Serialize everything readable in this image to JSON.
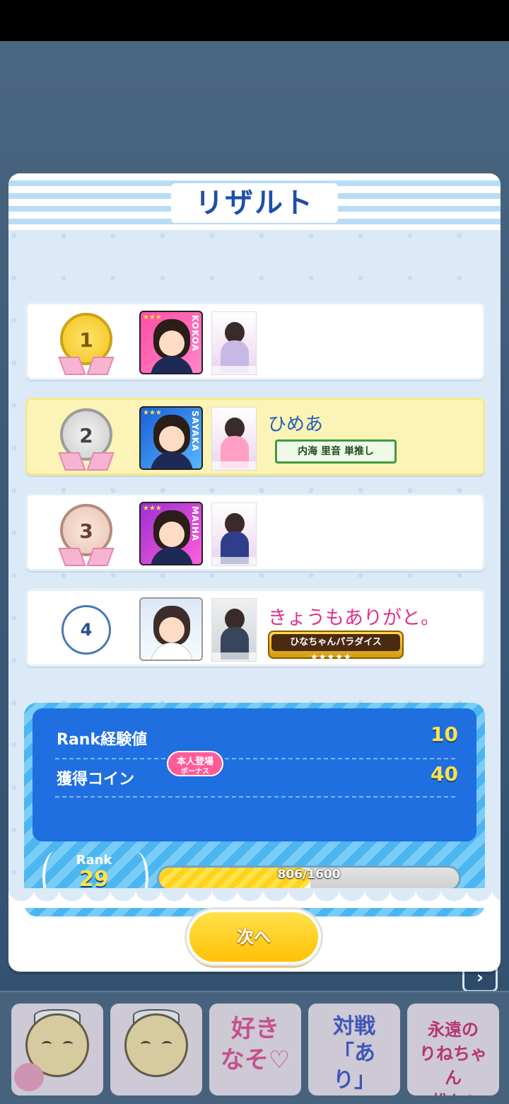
{
  "modal": {
    "title": "リザルト",
    "next_label": "次へ"
  },
  "results": [
    {
      "rank": "1",
      "avatar_name": "KOKOA",
      "player_name": "",
      "tag": ""
    },
    {
      "rank": "2",
      "avatar_name": "SAYAKA",
      "player_name": "ひめあ",
      "tag": "内海 里音 単推し"
    },
    {
      "rank": "3",
      "avatar_name": "MAIHA",
      "player_name": "",
      "tag": ""
    },
    {
      "rank": "4",
      "avatar_name": "",
      "player_name": "きょうもありがと。",
      "tag": "ひなちゃんパラダイス"
    }
  ],
  "stats": {
    "rank_exp_label": "Rank経験値",
    "rank_exp_value": "10",
    "coin_label": "獲得コイン",
    "coin_value": "40",
    "bonus_label": "本人登場",
    "bonus_sub": "ボーナス",
    "rank_label": "Rank",
    "rank_value": "29",
    "xp_text": "806/1600",
    "xp_current": 806,
    "xp_max": 1600
  },
  "stamps": [
    {
      "text": ""
    },
    {
      "text": ""
    },
    {
      "text": "好き\nなそ♡"
    },
    {
      "text": "対戦\n「あり」\nがとう♡"
    },
    {
      "text": "永遠の\nりねちゃん\n推し!"
    }
  ],
  "colors": {
    "title_blue": "#1c4fa8",
    "exp_yellow": "#ffe24a",
    "panel_blue": "#1f6fe0",
    "highlight_row": "#fbf4b6"
  }
}
